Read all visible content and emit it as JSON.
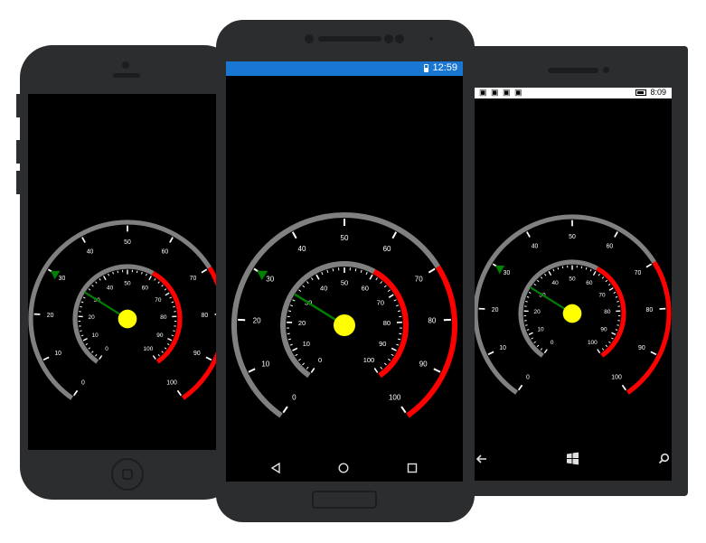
{
  "status": {
    "android_time": "12:59",
    "windows_time": "8:09",
    "windows_icons": "▣ ▣ ▣ ▣"
  },
  "gauge": {
    "outer": {
      "min": 0,
      "max": 100,
      "labels": [
        "0",
        "10",
        "20",
        "30",
        "40",
        "50",
        "60",
        "70",
        "80",
        "90",
        "100"
      ],
      "range_start": 70,
      "range_end": 100,
      "pointer_value": 30
    },
    "inner": {
      "min": 0,
      "max": 100,
      "labels": [
        "0",
        "10",
        "20",
        "30",
        "40",
        "50",
        "60",
        "70",
        "80",
        "90",
        "100"
      ],
      "range_start": 60,
      "range_end": 100,
      "needle_value": 30
    },
    "colors": {
      "track": "#808080",
      "range": "#ff0000",
      "needle": "#008000",
      "pointer": "#008000",
      "cap": "#ffff00",
      "ticks": "#ffffff",
      "labels": "#ffffff"
    }
  },
  "nav": {
    "android_back_icon": "triangle-back-icon",
    "android_home_icon": "circle-home-icon",
    "android_recents_icon": "square-recents-icon",
    "windows_back_icon": "arrow-back-icon",
    "windows_start_icon": "windows-logo-icon",
    "windows_search_icon": "search-icon"
  }
}
